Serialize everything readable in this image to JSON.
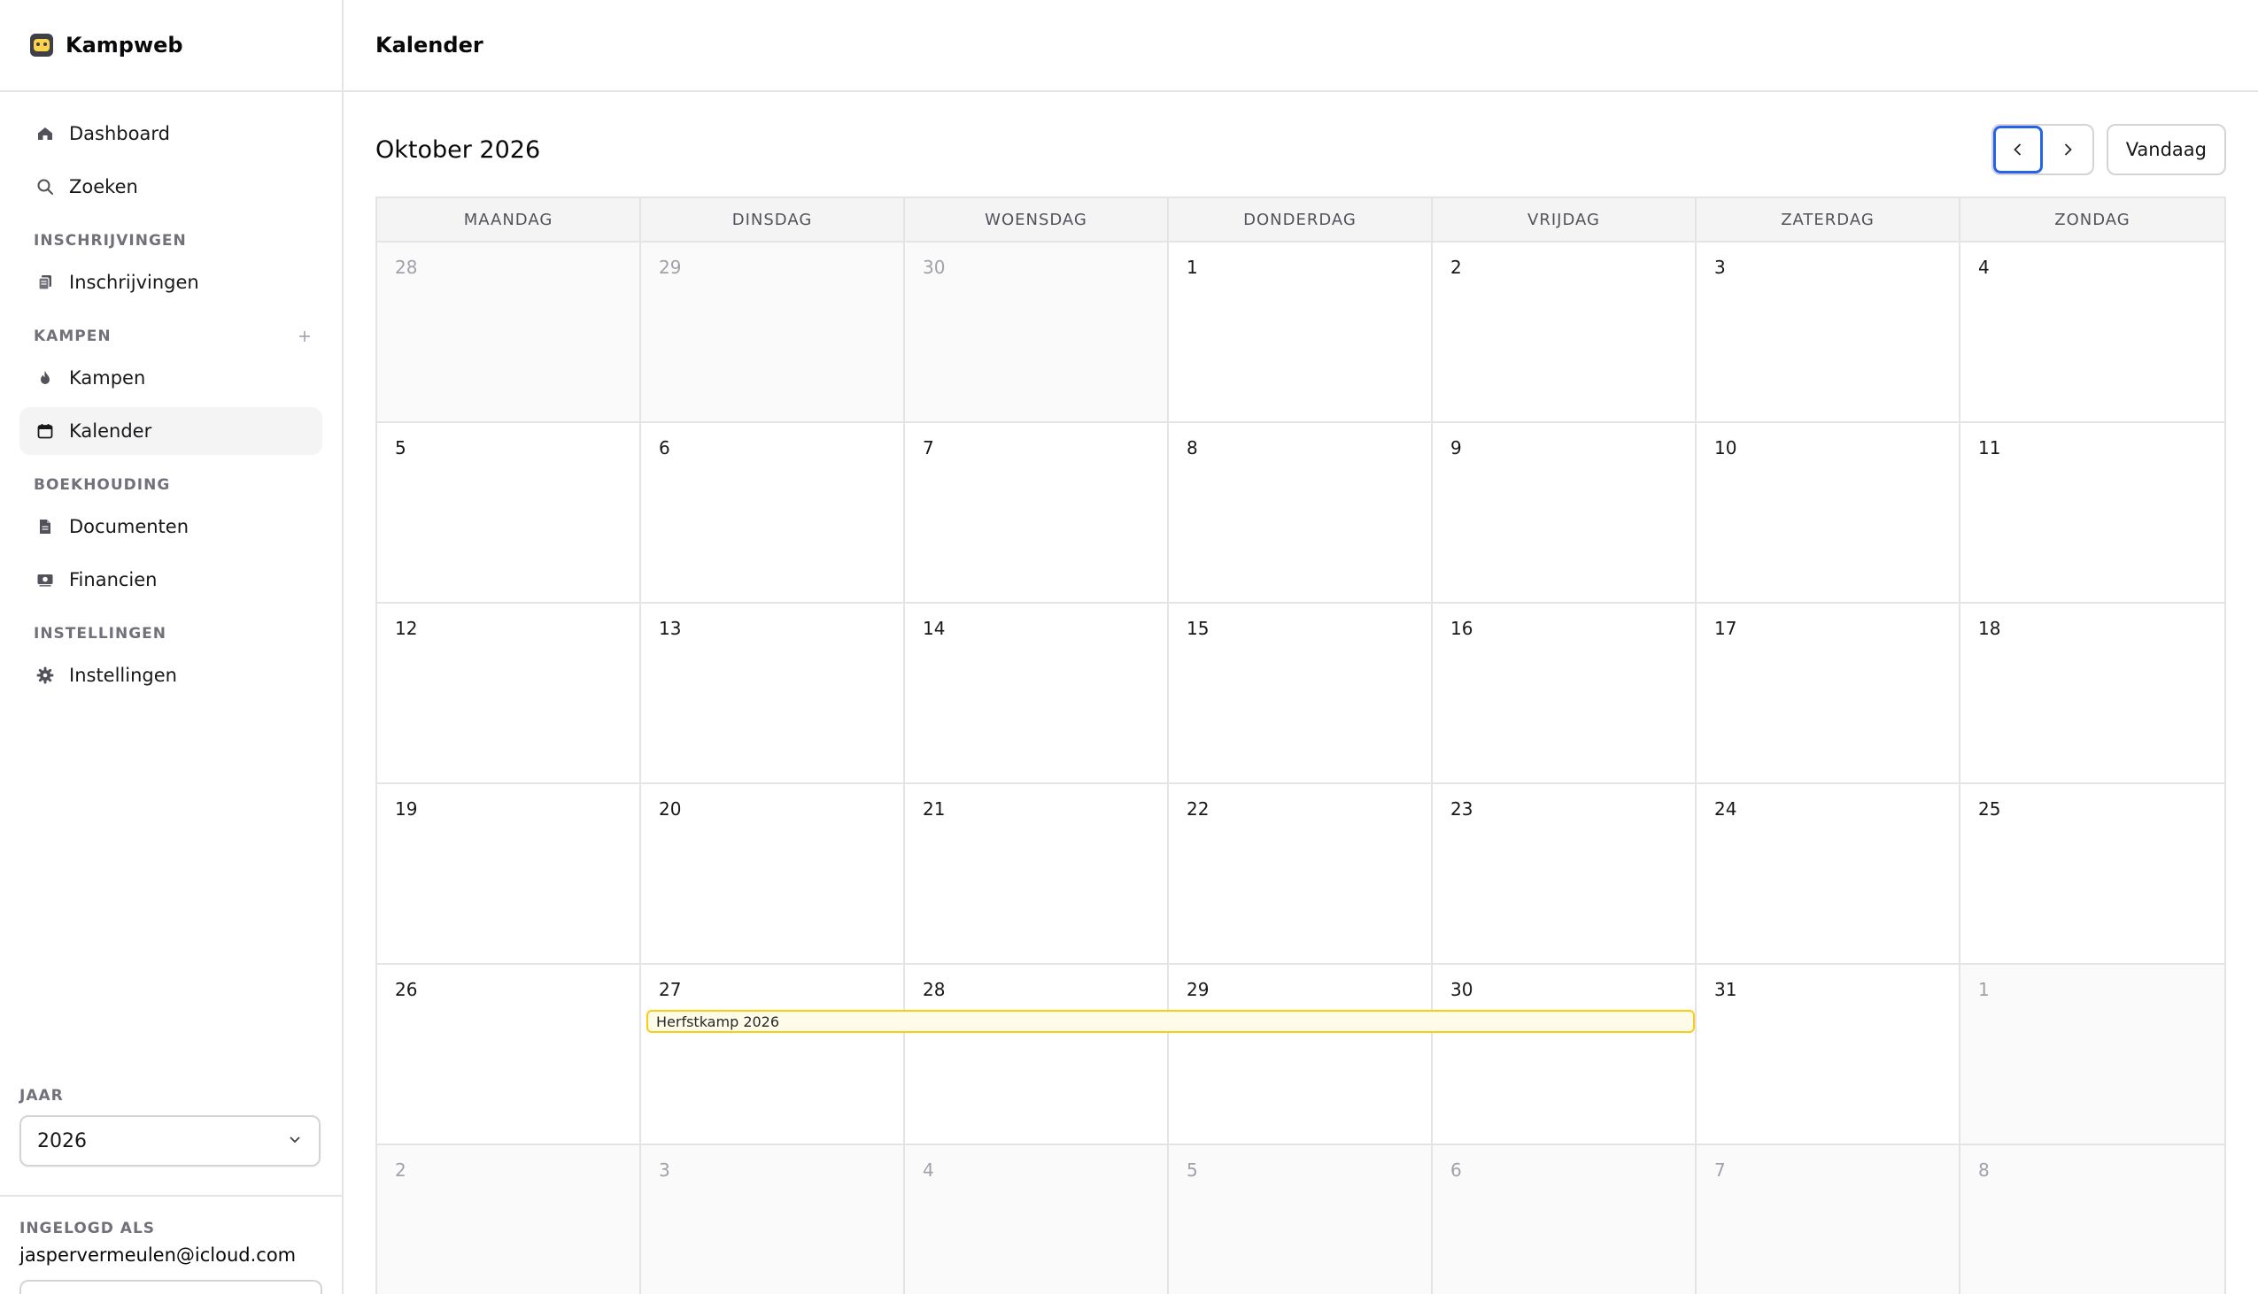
{
  "app": {
    "name": "Kampweb"
  },
  "sidebar": {
    "items": {
      "dashboard": "Dashboard",
      "zoeken": "Zoeken",
      "inschrijvingen": "Inschrijvingen",
      "kampen": "Kampen",
      "kalender": "Kalender",
      "documenten": "Documenten",
      "financien": "Financien",
      "instellingen": "Instellingen"
    },
    "sections": {
      "inschrijvingen": "INSCHRIJVINGEN",
      "kampen": "KAMPEN",
      "boekhouding": "BOEKHOUDING",
      "instellingen": "INSTELLINGEN"
    },
    "active_item": "Kalender",
    "year": {
      "label": "JAAR",
      "value": "2026"
    },
    "user": {
      "label": "INGELOGD ALS",
      "email": "jaspervermeulen@icloud.com"
    }
  },
  "header": {
    "title": "Kalender"
  },
  "calendar": {
    "month_title": "Oktober 2026",
    "today_label": "Vandaag",
    "weekdays": [
      "MAANDAG",
      "DINSDAG",
      "WOENSDAG",
      "DONDERDAG",
      "VRIJDAG",
      "ZATERDAG",
      "ZONDAG"
    ],
    "days": [
      {
        "n": "28",
        "other": true
      },
      {
        "n": "29",
        "other": true
      },
      {
        "n": "30",
        "other": true
      },
      {
        "n": "1"
      },
      {
        "n": "2"
      },
      {
        "n": "3"
      },
      {
        "n": "4"
      },
      {
        "n": "5"
      },
      {
        "n": "6"
      },
      {
        "n": "7"
      },
      {
        "n": "8"
      },
      {
        "n": "9"
      },
      {
        "n": "10"
      },
      {
        "n": "11"
      },
      {
        "n": "12"
      },
      {
        "n": "13"
      },
      {
        "n": "14"
      },
      {
        "n": "15"
      },
      {
        "n": "16"
      },
      {
        "n": "17"
      },
      {
        "n": "18"
      },
      {
        "n": "19"
      },
      {
        "n": "20"
      },
      {
        "n": "21"
      },
      {
        "n": "22"
      },
      {
        "n": "23"
      },
      {
        "n": "24"
      },
      {
        "n": "25"
      },
      {
        "n": "26"
      },
      {
        "n": "27"
      },
      {
        "n": "28"
      },
      {
        "n": "29"
      },
      {
        "n": "30"
      },
      {
        "n": "31"
      },
      {
        "n": "1",
        "other": true
      },
      {
        "n": "2",
        "other": true
      },
      {
        "n": "3",
        "other": true
      },
      {
        "n": "4",
        "other": true
      },
      {
        "n": "5",
        "other": true
      },
      {
        "n": "6",
        "other": true
      },
      {
        "n": "7",
        "other": true
      },
      {
        "n": "8",
        "other": true
      }
    ],
    "events": [
      {
        "title": "Herfstkamp 2026",
        "start": "27",
        "end": "30",
        "color": "#facc15"
      }
    ]
  }
}
